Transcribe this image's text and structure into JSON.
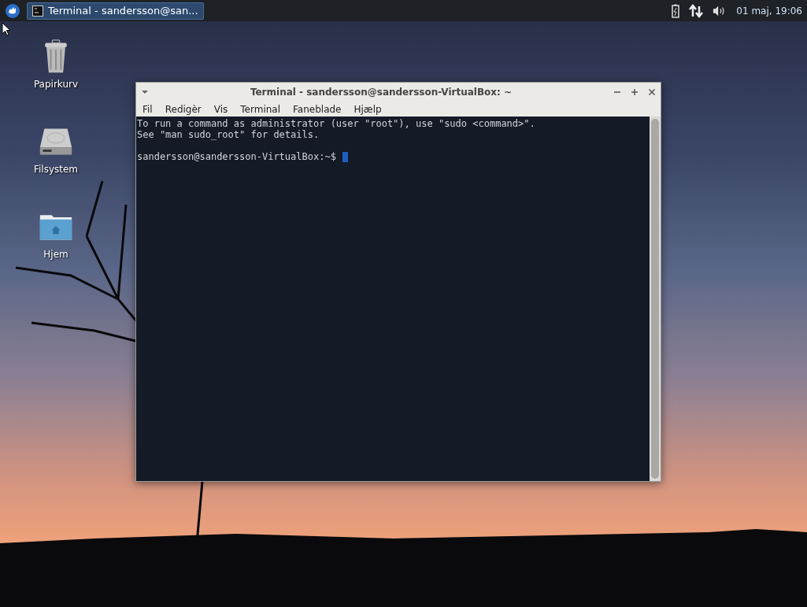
{
  "panel": {
    "tasks": [
      {
        "label": "Terminal - sandersson@san...",
        "selected": true
      }
    ],
    "clock": "01 maj, 19:06"
  },
  "desktop_icons": [
    {
      "label": "Papirkurv",
      "kind": "trash"
    },
    {
      "label": "Filsystem",
      "kind": "drive"
    },
    {
      "label": "Hjem",
      "kind": "home"
    }
  ],
  "window": {
    "title": "Terminal - sandersson@sandersson-VirtualBox: ~",
    "menu": [
      "Fil",
      "Redigèr",
      "Vis",
      "Terminal",
      "Faneblade",
      "Hjælp"
    ],
    "output": [
      "To run a command as administrator (user \"root\"), use \"sudo <command>\".",
      "See \"man sudo_root\" for details."
    ],
    "prompt": "sandersson@sandersson-VirtualBox:~$"
  }
}
